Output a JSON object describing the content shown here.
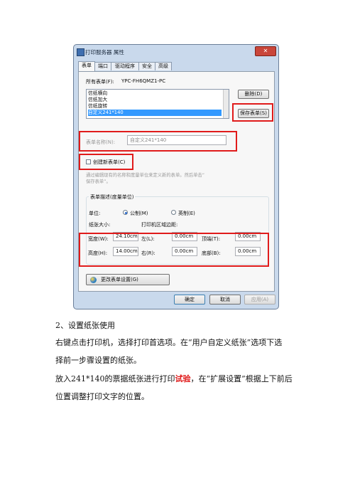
{
  "window": {
    "title": "打印服务器 属性",
    "close_glyph": "✕",
    "tabs": [
      "表单",
      "端口",
      "驱动程序",
      "安全",
      "高级"
    ]
  },
  "forms": {
    "all_forms_label": "所有表单(F):",
    "server_name": "YPC-FH6QMZ1-PC",
    "items": [
      "信纸横向",
      "信纸加大",
      "信纸旋转",
      "自定义241*140"
    ],
    "selected_index": 3,
    "delete_button": "删除(D)",
    "save_button": "保存表单(S)"
  },
  "form_name": {
    "label": "表单名称(N):",
    "value": "自定义241*140"
  },
  "create_new": {
    "label": "创建新表单(C)",
    "checked": false,
    "hint_line1": "通过编辑现有的名称和度量单位来定义新的表单。然后单击“",
    "hint_line2": "保存表单”。"
  },
  "description": {
    "group_title": "表单描述(度量单位)",
    "unit_label": "单位:",
    "metric_label": "公制(M)",
    "english_label": "英制(E)",
    "selected_unit": "metric",
    "paper_size_label": "纸张大小:",
    "margins_label": "打印机区域边距:",
    "width_label": "宽度(W):",
    "width_value": "24.10cm",
    "height_label": "高度(H):",
    "height_value": "14.00cm",
    "left_label": "左(L):",
    "left_value": "0.00cm",
    "right_label": "右(R):",
    "right_value": "0.00cm",
    "top_label": "顶端(T):",
    "top_value": "0.00cm",
    "bottom_label": "底部(B):",
    "bottom_value": "0.00cm"
  },
  "change_settings_button": "更改表单设置(G)",
  "footer": {
    "ok": "确定",
    "cancel": "取消",
    "apply": "应用(A)"
  },
  "doc": {
    "step": "2、设置纸张使用",
    "para1_line1": "右键点击打印机，选择打印首选项。在“用户自定义纸张”选项下选",
    "para1_line2": "择前一步骤设置的纸张。",
    "para2_prefix": "放入241*140的票据纸张进行打印",
    "para2_highlight": "试验",
    "para2_suffix": "，在“扩展设置”根据上下前后",
    "para2_line2": "位置调整打印文字的位置。"
  },
  "colors": {
    "annotation_red": "#e01b1b",
    "selection_blue": "#3399ff",
    "window_frame": "#c9d9ec"
  }
}
